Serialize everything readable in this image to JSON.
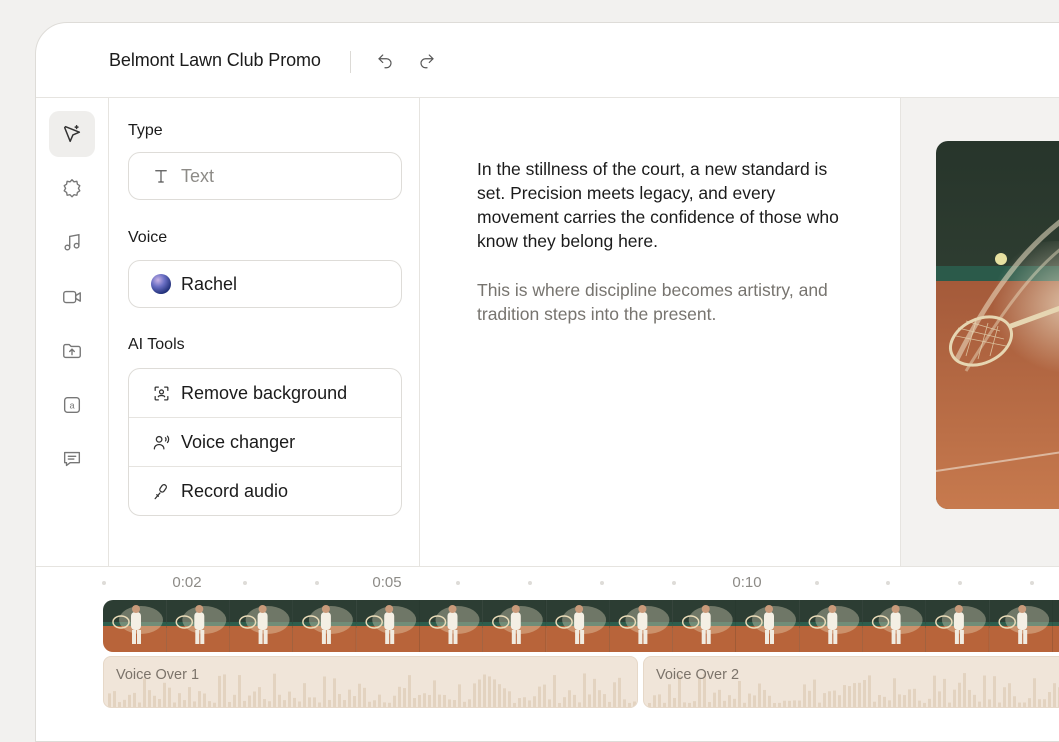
{
  "header": {
    "project_title": "Belmont Lawn Club Promo",
    "undo_icon": "undo-icon",
    "redo_icon": "redo-icon"
  },
  "rail": {
    "items": [
      {
        "icon": "magic-wand-icon",
        "active": true
      },
      {
        "icon": "badge-icon",
        "active": false
      },
      {
        "icon": "music-note-icon",
        "active": false
      },
      {
        "icon": "video-camera-icon",
        "active": false
      },
      {
        "icon": "upload-folder-icon",
        "active": false
      },
      {
        "icon": "text-box-icon",
        "active": false
      },
      {
        "icon": "message-icon",
        "active": false
      }
    ]
  },
  "panel": {
    "type_label": "Type",
    "type_value": "Text",
    "voice_label": "Voice",
    "voice_value": "Rachel",
    "ai_tools_label": "AI Tools",
    "tools": [
      {
        "label": "Remove background",
        "icon": "remove-background-icon"
      },
      {
        "label": "Voice changer",
        "icon": "voice-changer-icon"
      },
      {
        "label": "Record audio",
        "icon": "microphone-icon"
      }
    ]
  },
  "script": {
    "paragraph_1": "In the stillness of the court, a new standard is set. Precision meets legacy, and every movement carries the confidence of those who know they belong here.",
    "paragraph_2": "This is where discipline becomes artistry, and tradition steps into the present."
  },
  "timeline": {
    "markers": [
      "0:02",
      "0:05",
      "0:10"
    ],
    "clips": [
      {
        "label": "Voice Over 1"
      },
      {
        "label": "Voice Over 2"
      }
    ]
  },
  "colors": {
    "accent_clay": "#c0643a",
    "court_green": "#2f5a46",
    "voice_clip": "#f0e5d9"
  }
}
